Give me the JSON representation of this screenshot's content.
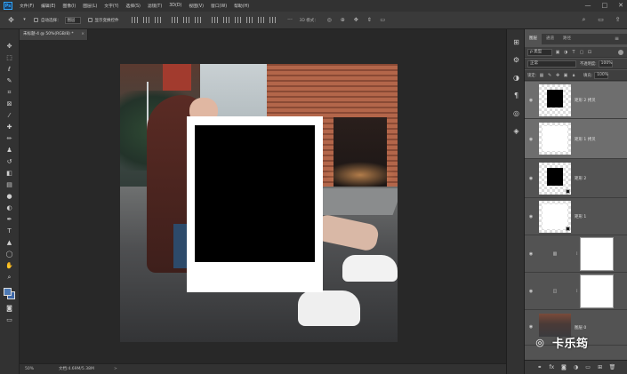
{
  "menu": {
    "logo": "Ps",
    "items": [
      "文件(F)",
      "编辑(E)",
      "图像(I)",
      "图层(L)",
      "文字(Y)",
      "选择(S)",
      "滤镜(T)",
      "3D(D)",
      "视图(V)",
      "窗口(W)",
      "帮助(H)"
    ],
    "window_controls": [
      "—",
      "□",
      "✕"
    ]
  },
  "options": {
    "auto_select_label": "自动选择：",
    "auto_select_value": "图层",
    "transform_label": "显示变换控件",
    "mode_3d": "3D 模式："
  },
  "document": {
    "tab_title": "未标题-4 @ 50%(RGB/8) *",
    "tab_close": "×",
    "zoom": "50%",
    "doc_info": "文档:4.69M/5.38M",
    "status_arrow": ">"
  },
  "panel": {
    "tabs": [
      "图层",
      "通道",
      "路径"
    ],
    "active_tab": "图层",
    "menu_icon": "≡",
    "filter_kind": "ρ 类型",
    "blend_mode": "正常",
    "opacity_label": "不透明度:",
    "opacity_value": "100%",
    "lock_label": "锁定:",
    "fill_label": "填充:",
    "fill_value": "100%",
    "layers": [
      {
        "name": "矩形 2 拷贝",
        "thumb": "black",
        "selected": true,
        "clipped": false
      },
      {
        "name": "矩形 1 拷贝",
        "thumb": "white",
        "selected": true,
        "clipped": false
      },
      {
        "name": "矩形 2",
        "thumb": "black",
        "selected": false,
        "clipped": true
      },
      {
        "name": "矩形 1",
        "thumb": "white",
        "selected": false,
        "clipped": true
      },
      {
        "name": "",
        "thumb": "adjustment",
        "selected": false,
        "clipped": false
      },
      {
        "name": "",
        "thumb": "adjustment",
        "selected": false,
        "clipped": false
      },
      {
        "name": "图层 0",
        "thumb": "photo",
        "selected": false,
        "clipped": false
      }
    ]
  },
  "watermark": {
    "text": "卡乐筠"
  },
  "colors": {
    "foreground": "#4d79b4",
    "background": "#3e67a6",
    "accent": "#31a8ff"
  }
}
